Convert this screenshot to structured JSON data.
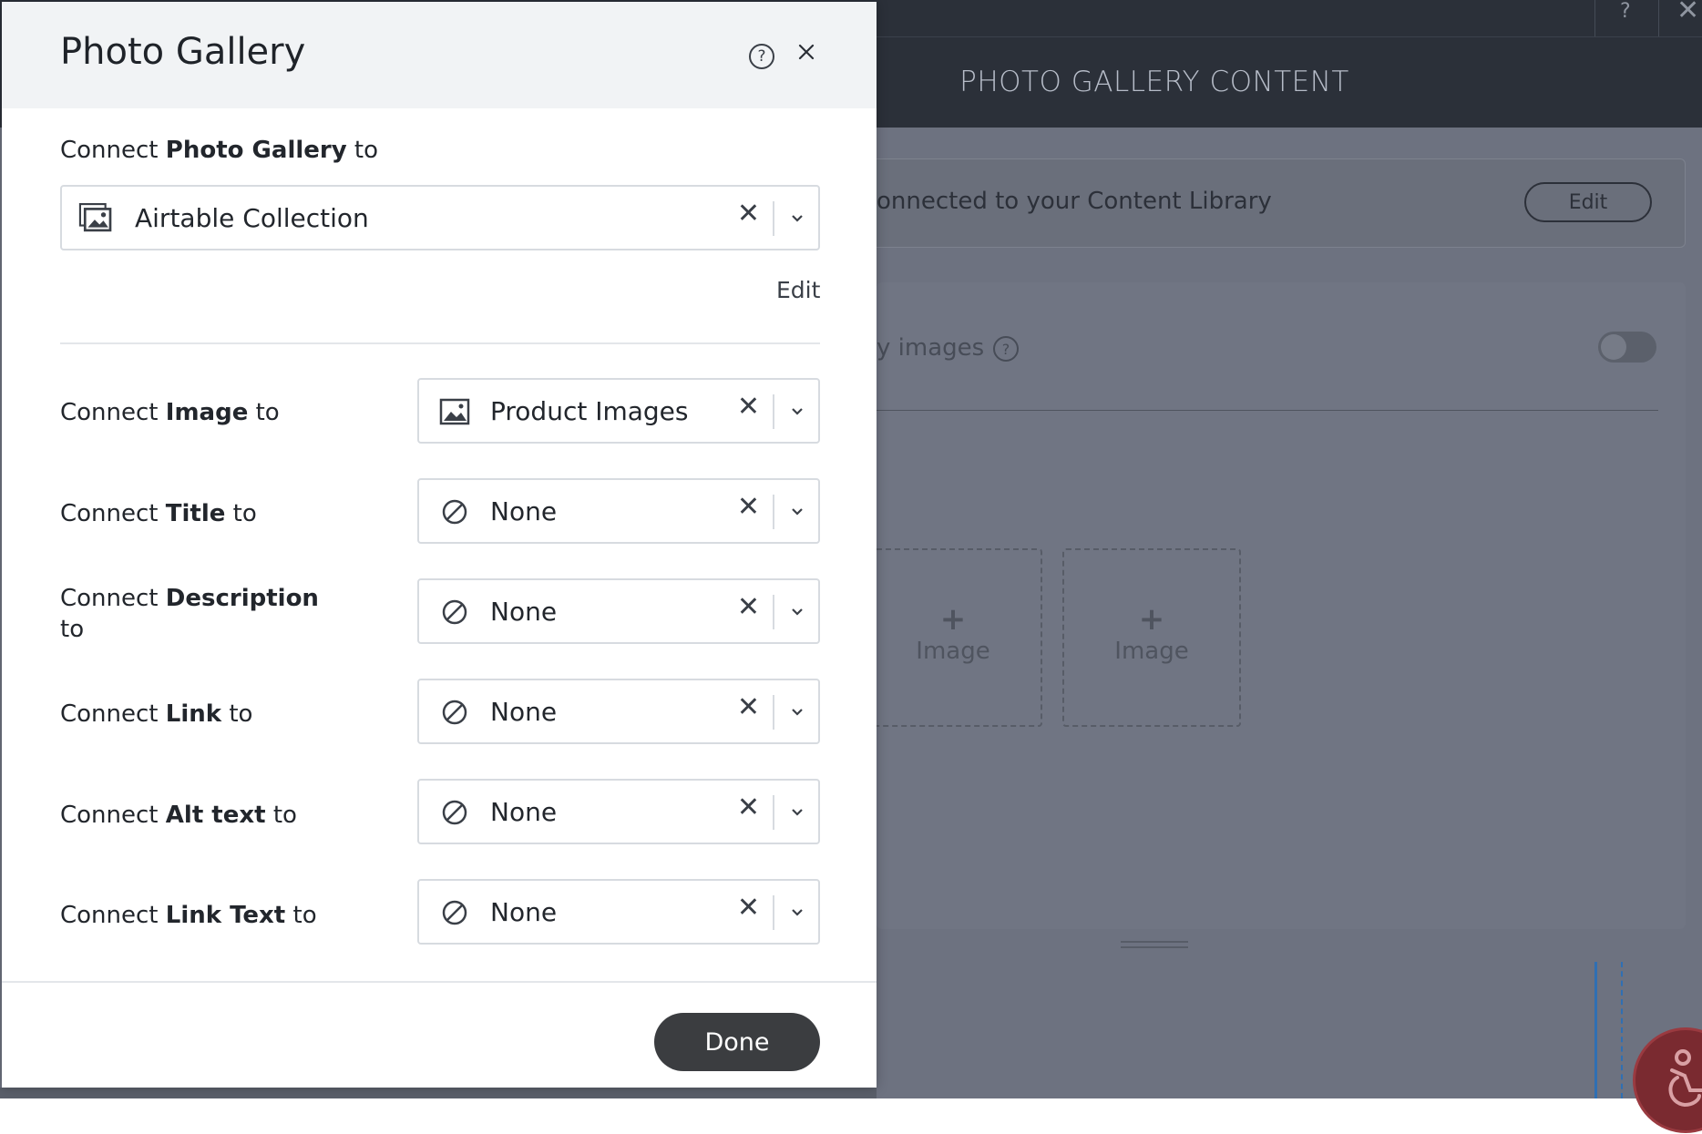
{
  "dialog": {
    "title": "Photo Gallery",
    "connect_prefix": "Connect ",
    "connect_bold": "Photo Gallery",
    "connect_suffix": " to",
    "collection_value": "Airtable Collection",
    "edit_link": "Edit",
    "rows": [
      {
        "prefix": "Connect ",
        "bold": "Image",
        "suffix": " to",
        "value": "Product Images",
        "icon": "image-icon"
      },
      {
        "prefix": "Connect ",
        "bold": "Title",
        "suffix": " to",
        "value": "None",
        "icon": "none-icon"
      },
      {
        "prefix": "Connect ",
        "bold": "Description",
        "suffix": "to",
        "value": "None",
        "icon": "none-icon"
      },
      {
        "prefix": "Connect ",
        "bold": "Link",
        "suffix": " to",
        "value": "None",
        "icon": "none-icon"
      },
      {
        "prefix": "Connect ",
        "bold": "Alt text",
        "suffix": " to",
        "value": "None",
        "icon": "none-icon"
      },
      {
        "prefix": "Connect ",
        "bold": "Link Text",
        "suffix": " to",
        "value": "None",
        "icon": "none-icon"
      }
    ],
    "done_label": "Done",
    "clear_glyph": "✕",
    "help_glyph": "?"
  },
  "background": {
    "panel_title": "PHOTO GALLERY CONTENT",
    "connected_text": "onnected to your Content Library",
    "edit_button": "Edit",
    "images_label": "y images",
    "image_slot_plus": "+",
    "image_slot_label": "Image",
    "help_glyph": "?",
    "close_glyph": "✕"
  },
  "colors": {
    "done_button": "#3b3d40",
    "header_bg": "#f1f3f5",
    "editor_header": "#2b3039",
    "overlay": "#6d7280"
  }
}
